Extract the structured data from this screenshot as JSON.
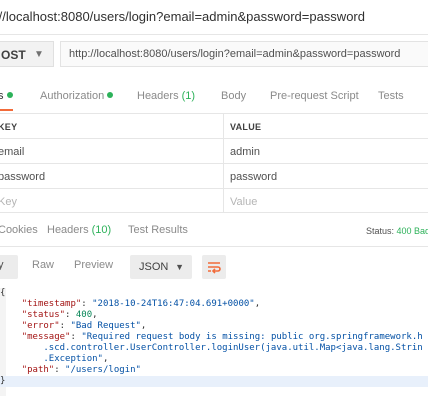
{
  "title": "://localhost:8080/users/login?email=admin&password=password",
  "request": {
    "method": "OST",
    "url": "http://localhost:8080/users/login?email=admin&password=password"
  },
  "tabs": [
    {
      "label": "s"
    },
    {
      "label": "Authorization"
    },
    {
      "label": "Headers",
      "count": "(1)"
    },
    {
      "label": "Body"
    },
    {
      "label": "Pre-request Script"
    },
    {
      "label": "Tests"
    }
  ],
  "params": {
    "headers": {
      "key": "KEY",
      "value": "VALUE"
    },
    "rows": [
      {
        "key": "email",
        "value": "admin"
      },
      {
        "key": "password",
        "value": "password"
      }
    ],
    "placeholder": {
      "key": "Key",
      "value": "Value"
    }
  },
  "response": {
    "tabs": [
      {
        "label": "Cookies"
      },
      {
        "label": "Headers",
        "count": "(10)"
      },
      {
        "label": "Test Results"
      }
    ],
    "status_label": "Status:",
    "status_value": "400 Bad"
  },
  "view": {
    "pretty": "y",
    "raw": "Raw",
    "preview": "Preview",
    "format": "JSON"
  },
  "body_lines": [
    {
      "pre": "{",
      "key": "",
      "mid": "",
      "val": "",
      "post": ""
    },
    {
      "pre": "    ",
      "key": "\"timestamp\"",
      "mid": ": ",
      "val": "\"2018-10-24T16:47:04.691+0000\"",
      "post": ","
    },
    {
      "pre": "    ",
      "key": "\"status\"",
      "mid": ": ",
      "val": "400",
      "post": ","
    },
    {
      "pre": "    ",
      "key": "\"error\"",
      "mid": ": ",
      "val": "\"Bad Request\"",
      "post": ","
    },
    {
      "pre": "    ",
      "key": "\"message\"",
      "mid": ": ",
      "val": "\"Required request body is missing: public org.springframework.h",
      "post": ""
    },
    {
      "pre": "        ",
      "key": "",
      "mid": "",
      "val": ".scd.controller.UserController.loginUser(java.util.Map<java.lang.Strin",
      "post": ""
    },
    {
      "pre": "        ",
      "key": "",
      "mid": "",
      "val": ".Exception\"",
      "post": ","
    },
    {
      "pre": "    ",
      "key": "\"path\"",
      "mid": ": ",
      "val": "\"/users/login\"",
      "post": ""
    },
    {
      "pre": "}",
      "key": "",
      "mid": "",
      "val": "",
      "post": ""
    }
  ]
}
